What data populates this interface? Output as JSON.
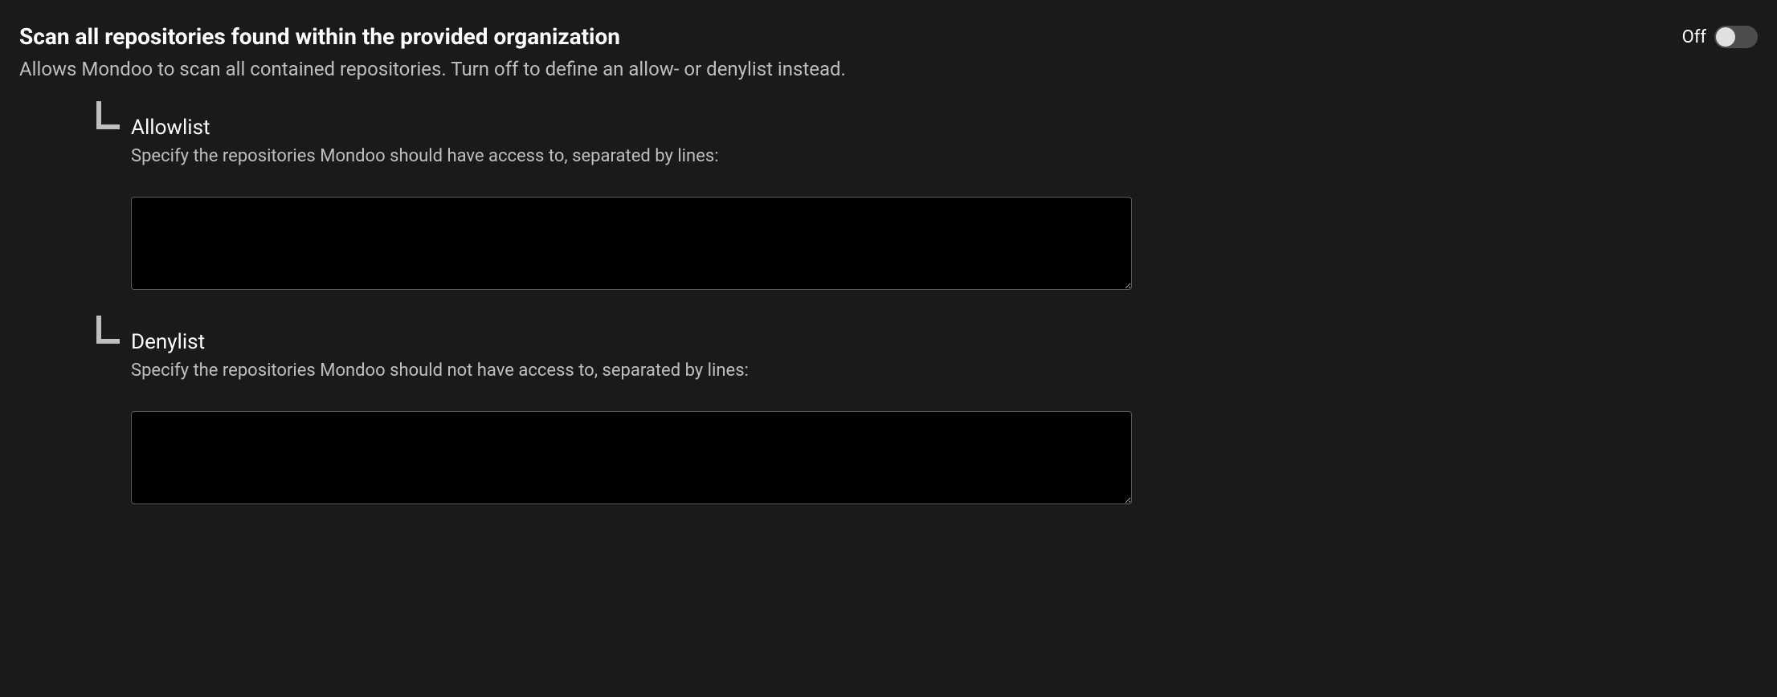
{
  "header": {
    "title": "Scan all repositories found within the provided organization",
    "description": "Allows Mondoo to scan all contained repositories. Turn off to define an allow- or denylist instead.",
    "toggle": {
      "label": "Off",
      "state": "off"
    }
  },
  "sections": {
    "allowlist": {
      "title": "Allowlist",
      "description": "Specify the repositories Mondoo should have access to, separated by lines:",
      "value": ""
    },
    "denylist": {
      "title": "Denylist",
      "description": "Specify the repositories Mondoo should not have access to, separated by lines:",
      "value": ""
    }
  }
}
